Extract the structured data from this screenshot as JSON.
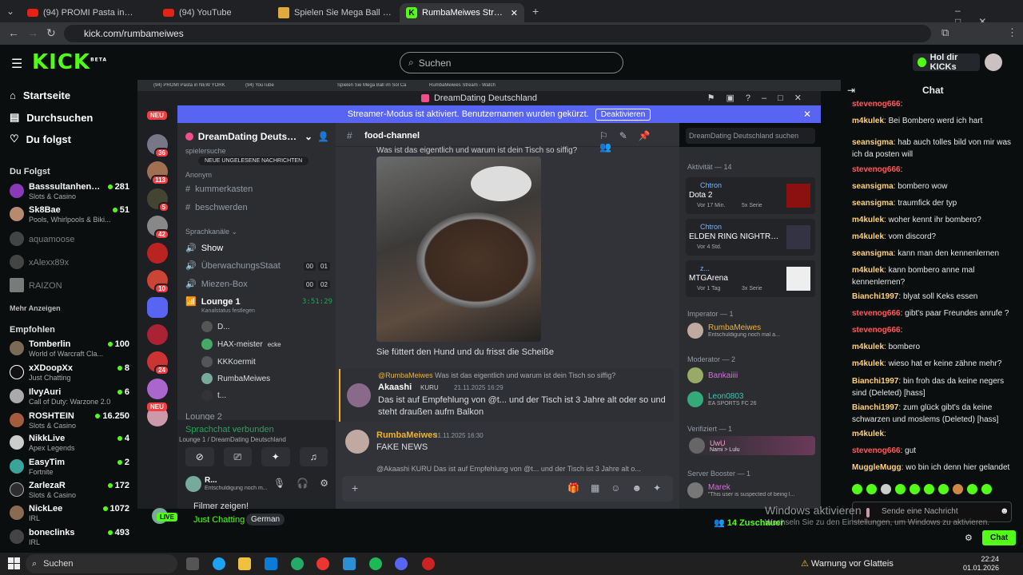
{
  "browser": {
    "tabs": [
      {
        "label": "(94) PROMI Pasta in NEW YORK"
      },
      {
        "label": "(94) YouTube"
      },
      {
        "label": "Spielen Sie Mega Ball im Sol Ca"
      },
      {
        "label": "RumbaMeiwes Stream - Watch"
      }
    ],
    "url": "kick.com/rumbameiwes"
  },
  "kick": {
    "logo": "KICK",
    "logo_beta": "BETA",
    "search_placeholder": "Suchen",
    "kicks_button": "Hol dir KICKs",
    "nav": [
      {
        "label": "Startseite"
      },
      {
        "label": "Durchsuchen"
      },
      {
        "label": "Du folgst"
      }
    ],
    "following_header": "Du Folgst",
    "following": [
      {
        "name": "Basssultanhengzt45",
        "cat": "Slots & Casino",
        "viewers": "281"
      },
      {
        "name": "Sk8Bae",
        "cat": "Pools, Whirlpools & Biki...",
        "viewers": "51"
      },
      {
        "name": "aquamoose",
        "cat": "",
        "viewers": ""
      },
      {
        "name": "xAlexx89x",
        "cat": "",
        "viewers": ""
      },
      {
        "name": "RAIZON",
        "cat": "",
        "viewers": ""
      }
    ],
    "show_more": "Mehr Anzeigen",
    "recommended_header": "Empfohlen",
    "recommended": [
      {
        "name": "Tomberlin",
        "cat": "World of Warcraft Cla...",
        "viewers": "100"
      },
      {
        "name": "xXDoopXx",
        "cat": "Just Chatting",
        "viewers": "8"
      },
      {
        "name": "IlvyAuri",
        "cat": "Call of Duty: Warzone 2.0",
        "viewers": "6"
      },
      {
        "name": "ROSHTEIN",
        "cat": "Slots & Casino",
        "viewers": "16.250"
      },
      {
        "name": "NikkLive",
        "cat": "Apex Legends",
        "viewers": "4"
      },
      {
        "name": "EasyTim",
        "cat": "Fortnite",
        "viewers": "2"
      },
      {
        "name": "ZarlezaR",
        "cat": "Slots & Casino",
        "viewers": "172"
      },
      {
        "name": "NickLee",
        "cat": "IRL",
        "viewers": "1072"
      },
      {
        "name": "boneclinks",
        "cat": "IRL",
        "viewers": "493"
      }
    ],
    "stream": {
      "title": "Filmer zeigen!",
      "category": "Just Chatting",
      "tag": "German",
      "live": "LIVE",
      "viewers": "14 Zuschauer"
    }
  },
  "discord": {
    "inner_tabs": [
      "(94) PROMI Pasta in NEW YORK",
      "(94) YouTube",
      "Spielen Sie Mega Ball im Sol Ca",
      "RumbaMeiwes Stream - Watch"
    ],
    "window_title": "DreamDating Deutschland",
    "banner_text": "Streamer-Modus ist aktiviert. Benutzernamen wurden gekürzt.",
    "banner_button": "Deaktivieren",
    "server_badges": [
      "NEU",
      "36",
      "113",
      "5",
      "42",
      "10",
      "24",
      "NEU"
    ],
    "server_name": "DreamDating Deutschla...",
    "new_unread": "NEUE UNGELESENE NACHRICHTEN",
    "spielersuche": "spielersuche",
    "cat_anon": "Anonym",
    "text_channels": [
      "kummerkasten",
      "beschwerden"
    ],
    "cat_voice": "Sprachkanäle",
    "voice_channels": [
      {
        "name": "Show",
        "c1": "",
        "c2": ""
      },
      {
        "name": "ÜberwachungsStaat",
        "c1": "00",
        "c2": "01"
      },
      {
        "name": "Miezen-Box",
        "c1": "00",
        "c2": "02"
      }
    ],
    "lounge": {
      "name": "Lounge 1",
      "time": "3:51:29",
      "status": "Kanalstatus festlegen"
    },
    "lounge_users": [
      {
        "name": "D..."
      },
      {
        "name": "HAX-meister",
        "extra": "ecke"
      },
      {
        "name": "KKKoermit"
      },
      {
        "name": "RumbaMeiwes"
      },
      {
        "name": "t..."
      }
    ],
    "lounge2": "Lounge 2",
    "voice_connected": "Sprachchat verbunden",
    "voice_location": "Lounge 1 / DreamDating Deutschland",
    "user_name": "R...",
    "user_status": "Entschuldigung noch m...",
    "channel_name": "food-channel",
    "search_placeholder": "DreamDating Deutschland suchen",
    "messages": {
      "top_partial": "Was ist das eigentlich und warum ist dein Tisch so siffig?",
      "caption": "Sie füttert den Hund und du frisst die Scheiße",
      "reply_ref_user": "@RumbaMeiwes",
      "reply_ref_text": "Was ist das eigentlich und warum ist dein Tisch so siffig?",
      "m1_user": "Akaashi",
      "m1_tag": "KURU",
      "m1_time": "21.11.2025 16:29",
      "m1_text": "Das ist auf Empfehlung von @t... und der Tisch ist 3 Jahre alt oder so und steht draußen aufm Balkon",
      "m2_user": "RumbaMeiwes",
      "m2_time": "21.11.2025 16:30",
      "m2_text": "FAKE NEWS",
      "m3_ref": "@Akaashi  KURU  Das ist auf Empfehlung von @t... und der Tisch ist 3 Jahre alt o..."
    },
    "activity_header": "Aktivität — 14",
    "activities": [
      {
        "user": "Chtron",
        "game": "Dota 2",
        "meta": "Vor 17 Min.",
        "meta2": "5x Serie"
      },
      {
        "user": "Chtron",
        "game": "ELDEN RING NIGHTREIGN",
        "meta": "Vor 4 Std.",
        "meta2": ""
      },
      {
        "user": "z...",
        "game": "MTGArena",
        "meta": "Vor 1 Tag",
        "meta2": "3x Serie"
      }
    ],
    "imperator_header": "Imperator — 1",
    "imperator": {
      "name": "RumbaMeiwes",
      "status": "Entschuldigung noch mal a..."
    },
    "moderator_header": "Moderator — 2",
    "moderators": [
      {
        "name": "Bankaiiii",
        "status": ""
      },
      {
        "name": "Leon0803",
        "status": "EA SPORTS FC 26"
      }
    ],
    "verified_header": "Verifiziert — 1",
    "verified": {
      "name": "UwU",
      "status": "Nami > Lulu"
    },
    "booster_header": "Server Booster — 1",
    "booster": {
      "name": "Marek",
      "status": "\"This user is suspected of being l..."
    }
  },
  "chat": {
    "header": "Chat",
    "messages": [
      {
        "user": "stevenog666",
        "text": "",
        "color": "#ff5b5b"
      },
      {
        "user": "m4kulek",
        "text": "Bei Bombero werd ich hart",
        "color": "#ffd27a"
      },
      {
        "user": "seansigma",
        "text": "hab auch tolles bild von mir was ich da posten will",
        "color": "#ffd27a"
      },
      {
        "user": "stevenog666",
        "text": "",
        "color": "#ff5b5b"
      },
      {
        "user": "seansigma",
        "text": "bombero wow",
        "color": "#ffd27a"
      },
      {
        "user": "seansigma",
        "text": "traumfick der typ",
        "color": "#ffd27a"
      },
      {
        "user": "m4kulek",
        "text": "woher kennt ihr bombero?",
        "color": "#ffd27a"
      },
      {
        "user": "m4kulek",
        "text": "vom discord?",
        "color": "#ffd27a"
      },
      {
        "user": "seansigma",
        "text": "kann man den kennenlernen",
        "color": "#ffd27a"
      },
      {
        "user": "m4kulek",
        "text": "kann bombero anne mal kennenlernen?",
        "color": "#ffd27a"
      },
      {
        "user": "Bianchi1997",
        "text": "blyat soll Keks essen",
        "color": "#ffd27a"
      },
      {
        "user": "stevenog666",
        "text": "gibt's paar Freundes anrufe ?",
        "color": "#ff5b5b"
      },
      {
        "user": "stevenog666",
        "text": "",
        "color": "#ff5b5b"
      },
      {
        "user": "m4kulek",
        "text": "bombero",
        "color": "#ffd27a"
      },
      {
        "user": "m4kulek",
        "text": "wieso hat er keine zähne mehr?",
        "color": "#ffd27a"
      },
      {
        "user": "Bianchi1997",
        "text": "bin froh das da keine negers sind (Deleted) [hass]",
        "color": "#ffd27a"
      },
      {
        "user": "Bianchi1997",
        "text": "zum glück gibt's da keine schwarzen und moslems (Deleted) [hass]",
        "color": "#ffd27a"
      },
      {
        "user": "m4kulek",
        "text": "",
        "color": "#ffd27a"
      },
      {
        "user": "stevenog666",
        "text": "gut",
        "color": "#ff5b5b"
      },
      {
        "user": "MuggleMugg",
        "text": "wo bin ich denn hier gelandet",
        "color": "#ffd27a"
      }
    ],
    "ai_mod": "AI Mod",
    "input_placeholder": "Sende eine Nachricht",
    "send_button": "Chat"
  },
  "windows": {
    "activate_title": "Windows aktivieren",
    "activate_sub": "Wechseln Sie zu den Einstellungen, um Windows zu aktivieren.",
    "search": "Suchen",
    "weather": "Warnung vor Glatteis",
    "time": "22:24",
    "date": "01.01.2026"
  },
  "colors": {
    "kick_green": "#53fc18",
    "discord_blurple": "#5865f2",
    "live_red": "#e91916"
  }
}
